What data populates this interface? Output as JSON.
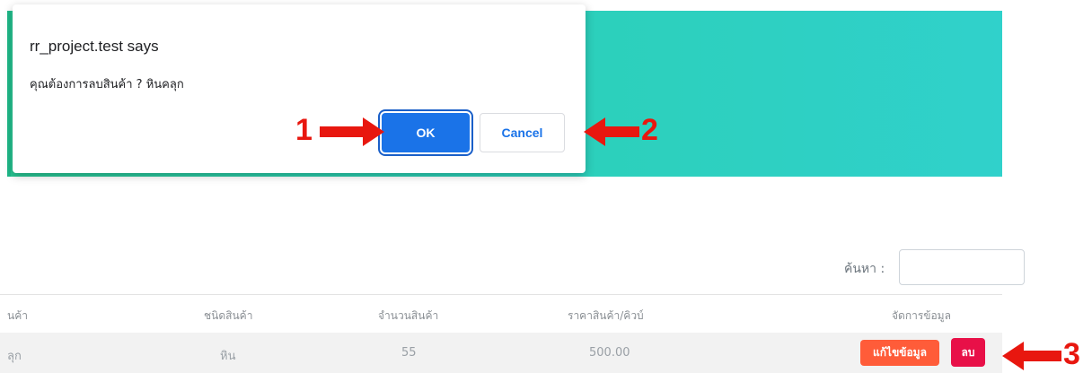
{
  "dialog": {
    "title": "rr_project.test says",
    "message": "คุณต้องการลบสินค้า ? หินคลุก",
    "ok_label": "OK",
    "cancel_label": "Cancel"
  },
  "callouts": {
    "one": "1",
    "two": "2",
    "three": "3"
  },
  "search": {
    "label": "ค้นหา :",
    "value": ""
  },
  "table": {
    "headers": [
      "นค้า",
      "ชนิดสินค้า",
      "จำนวนสินค้า",
      "ราคาสินค้า/คิวบ์",
      "จัดการข้อมูล"
    ],
    "rows": [
      {
        "name": "ลุก",
        "type": "หิน",
        "quantity": "55",
        "price": "500.00",
        "edit_label": "แก้ไขข้อมูล",
        "delete_label": "ลบ"
      }
    ]
  },
  "colors": {
    "banner_start": "#28c592",
    "banner_end": "#30d1cb",
    "ok_button": "#1a73e8",
    "edit_button": "#ff5c39",
    "delete_button": "#e81048",
    "annotation_red": "#e8170f"
  }
}
